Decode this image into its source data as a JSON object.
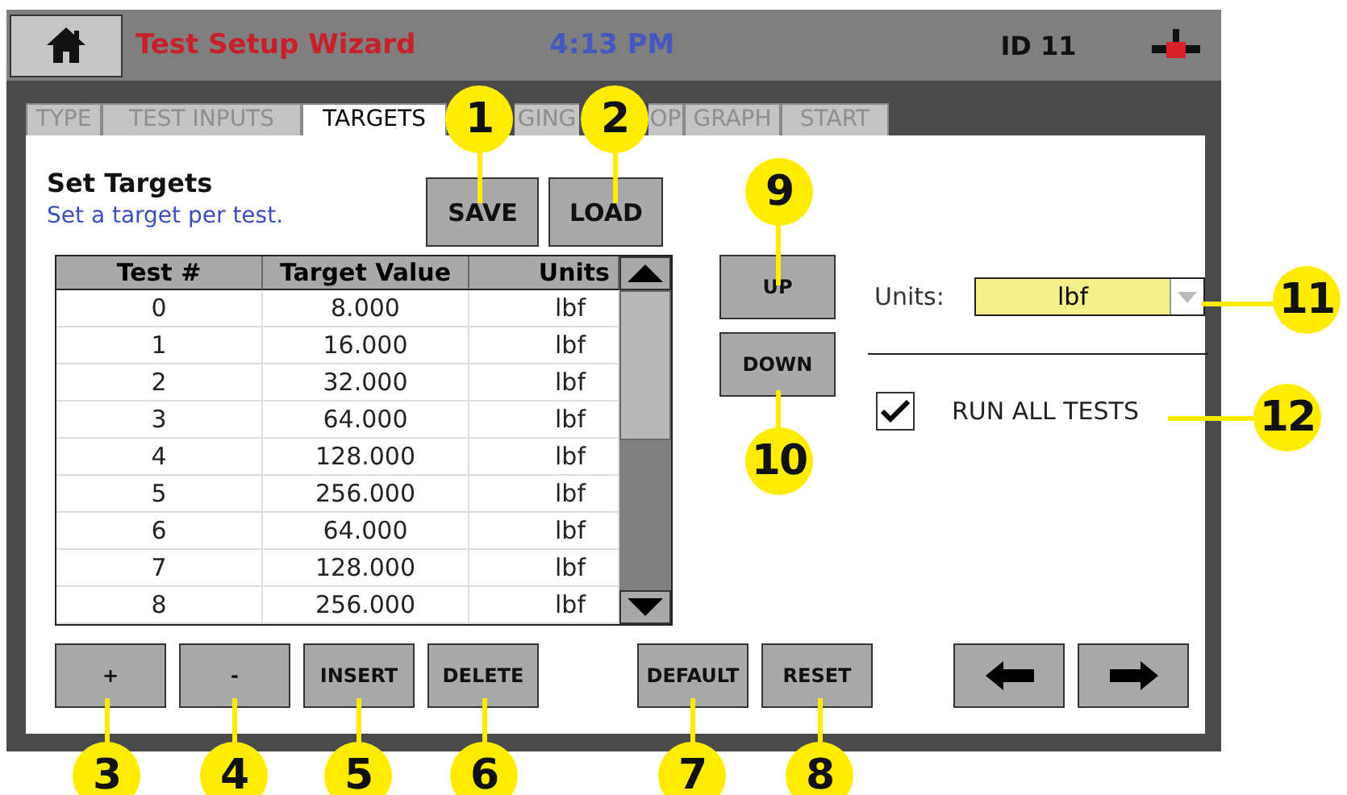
{
  "header": {
    "title": "Test Setup Wizard",
    "time": "4:13 PM",
    "id": "ID 11"
  },
  "tabs": [
    {
      "label": "TYPE",
      "selected": false
    },
    {
      "label": "TEST INPUTS",
      "selected": false
    },
    {
      "label": "TARGETS",
      "selected": true
    },
    {
      "label": "GING",
      "selected": false
    },
    {
      "label": "OP",
      "selected": false
    },
    {
      "label": "GRAPH",
      "selected": false
    },
    {
      "label": "START",
      "selected": false
    }
  ],
  "panel": {
    "title": "Set Targets",
    "subtitle": "Set a target per test."
  },
  "file_buttons": [
    "SAVE",
    "LOAD"
  ],
  "table": {
    "columns": [
      "Test #",
      "Target Value",
      "Units"
    ],
    "rows": [
      [
        "0",
        "8.000",
        "lbf"
      ],
      [
        "1",
        "16.000",
        "lbf"
      ],
      [
        "2",
        "32.000",
        "lbf"
      ],
      [
        "3",
        "64.000",
        "lbf"
      ],
      [
        "4",
        "128.000",
        "lbf"
      ],
      [
        "5",
        "256.000",
        "lbf"
      ],
      [
        "6",
        "64.000",
        "lbf"
      ],
      [
        "7",
        "128.000",
        "lbf"
      ],
      [
        "8",
        "256.000",
        "lbf"
      ]
    ]
  },
  "move_buttons": [
    "UP",
    "DOWN"
  ],
  "units": {
    "label": "Units:",
    "value": "lbf"
  },
  "run_all_tests": {
    "label": "RUN ALL TESTS",
    "checked": true
  },
  "row_buttons": [
    "+",
    "-",
    "INSERT",
    "DELETE"
  ],
  "reset_buttons": [
    "DEFAULT",
    "RESET"
  ],
  "callouts": [
    "1",
    "2",
    "3",
    "4",
    "5",
    "6",
    "7",
    "8",
    "9",
    "10",
    "11",
    "12"
  ]
}
